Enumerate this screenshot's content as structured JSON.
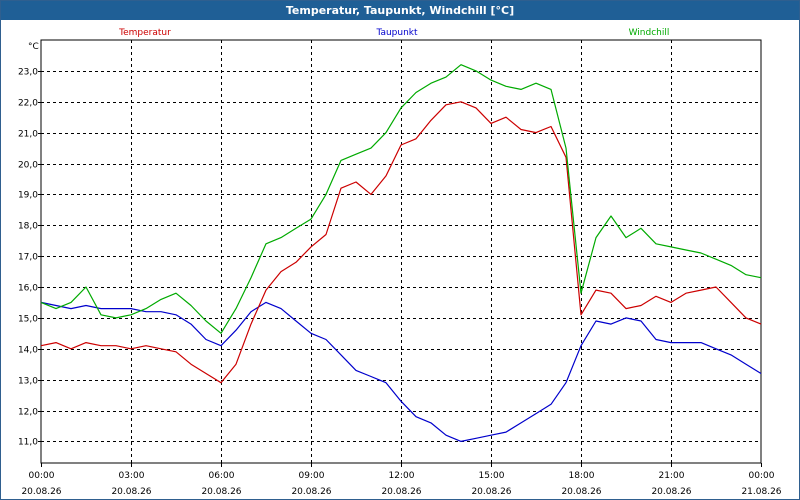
{
  "window": {
    "title": "Temperatur, Taupunkt, Windchill [°C]"
  },
  "colors": {
    "temperature": "#cc0000",
    "dewpoint": "#0000cc",
    "windchill": "#00aa00",
    "titlebar": "#1f5f96"
  },
  "chart_data": {
    "type": "line",
    "title": "Temperatur, Taupunkt, Windchill [°C]",
    "ylabel": "°C",
    "xlabel": "",
    "ylim": [
      10.3,
      24.0
    ],
    "xlim": [
      0,
      24
    ],
    "grid": true,
    "legend_position": "top",
    "yticks": [
      "11,0",
      "12,0",
      "13,0",
      "14,0",
      "15,0",
      "16,0",
      "17,0",
      "18,0",
      "19,0",
      "20,0",
      "21,0",
      "22,0",
      "23,0"
    ],
    "ytick_values": [
      11,
      12,
      13,
      14,
      15,
      16,
      17,
      18,
      19,
      20,
      21,
      22,
      23
    ],
    "xticks": [
      {
        "hour": 0,
        "time": "00:00",
        "date": "20.08.26"
      },
      {
        "hour": 3,
        "time": "03:00",
        "date": "20.08.26"
      },
      {
        "hour": 6,
        "time": "06:00",
        "date": "20.08.26"
      },
      {
        "hour": 9,
        "time": "09:00",
        "date": "20.08.26"
      },
      {
        "hour": 12,
        "time": "12:00",
        "date": "20.08.26"
      },
      {
        "hour": 15,
        "time": "15:00",
        "date": "20.08.26"
      },
      {
        "hour": 18,
        "time": "18:00",
        "date": "20.08.26"
      },
      {
        "hour": 21,
        "time": "21:00",
        "date": "20.08.26"
      },
      {
        "hour": 24,
        "time": "00:00",
        "date": "21.08.26"
      }
    ],
    "series": [
      {
        "name": "Temperatur",
        "color": "#cc0000",
        "x": [
          0,
          0.5,
          1,
          1.5,
          2,
          2.5,
          3,
          3.5,
          4,
          4.5,
          5,
          5.5,
          6,
          6.5,
          7,
          7.5,
          8,
          8.5,
          9,
          9.5,
          10,
          10.5,
          11,
          11.5,
          12,
          12.5,
          13,
          13.5,
          14,
          14.5,
          15,
          15.5,
          16,
          16.5,
          17,
          17.5,
          18,
          18.5,
          19,
          19.5,
          20,
          20.5,
          21,
          21.5,
          22,
          22.5,
          23,
          23.5,
          24
        ],
        "values": [
          14.1,
          14.2,
          14.0,
          14.2,
          14.1,
          14.1,
          14.0,
          14.1,
          14.0,
          13.9,
          13.5,
          13.2,
          12.9,
          13.5,
          14.8,
          15.9,
          16.5,
          16.8,
          17.3,
          17.7,
          19.2,
          19.4,
          19.0,
          19.6,
          20.6,
          20.8,
          21.4,
          21.9,
          22.0,
          21.8,
          21.3,
          21.5,
          21.1,
          21.0,
          21.2,
          20.2,
          15.1,
          15.9,
          15.8,
          15.3,
          15.4,
          15.7,
          15.5,
          15.8,
          15.9,
          16.0,
          15.5,
          15.0,
          14.8
        ]
      },
      {
        "name": "Taupunkt",
        "color": "#0000cc",
        "x": [
          0,
          0.5,
          1,
          1.5,
          2,
          2.5,
          3,
          3.5,
          4,
          4.5,
          5,
          5.5,
          6,
          6.5,
          7,
          7.5,
          8,
          8.5,
          9,
          9.5,
          10,
          10.5,
          11,
          11.5,
          12,
          12.5,
          13,
          13.5,
          14,
          14.5,
          15,
          15.5,
          16,
          16.5,
          17,
          17.5,
          18,
          18.5,
          19,
          19.5,
          20,
          20.5,
          21,
          21.5,
          22,
          22.5,
          23,
          23.5,
          24
        ],
        "values": [
          15.5,
          15.4,
          15.3,
          15.4,
          15.3,
          15.3,
          15.3,
          15.2,
          15.2,
          15.1,
          14.8,
          14.3,
          14.1,
          14.6,
          15.2,
          15.5,
          15.3,
          14.9,
          14.5,
          14.3,
          13.8,
          13.3,
          13.1,
          12.9,
          12.3,
          11.8,
          11.6,
          11.2,
          11.0,
          11.1,
          11.2,
          11.3,
          11.6,
          11.9,
          12.2,
          12.9,
          14.1,
          14.9,
          14.8,
          15.0,
          14.9,
          14.3,
          14.2,
          14.2,
          14.2,
          14.0,
          13.8,
          13.5,
          13.2
        ]
      },
      {
        "name": "Windchill",
        "color": "#00aa00",
        "x": [
          0,
          0.5,
          1,
          1.5,
          2,
          2.5,
          3,
          3.5,
          4,
          4.5,
          5,
          5.5,
          6,
          6.5,
          7,
          7.5,
          8,
          8.5,
          9,
          9.5,
          10,
          10.5,
          11,
          11.5,
          12,
          12.5,
          13,
          13.5,
          14,
          14.5,
          15,
          15.5,
          16,
          16.5,
          17,
          17.5,
          18,
          18.5,
          19,
          19.5,
          20,
          20.5,
          21,
          21.5,
          22,
          22.5,
          23,
          23.5,
          24
        ],
        "values": [
          15.5,
          15.3,
          15.5,
          16.0,
          15.1,
          15.0,
          15.1,
          15.3,
          15.6,
          15.8,
          15.4,
          14.9,
          14.5,
          15.3,
          16.3,
          17.4,
          17.6,
          17.9,
          18.2,
          19.0,
          20.1,
          20.3,
          20.5,
          21.0,
          21.8,
          22.3,
          22.6,
          22.8,
          23.2,
          23.0,
          22.7,
          22.5,
          22.4,
          22.6,
          22.4,
          20.5,
          15.8,
          17.6,
          18.3,
          17.6,
          17.9,
          17.4,
          17.3,
          17.2,
          17.1,
          16.9,
          16.7,
          16.4,
          16.3
        ]
      }
    ]
  }
}
